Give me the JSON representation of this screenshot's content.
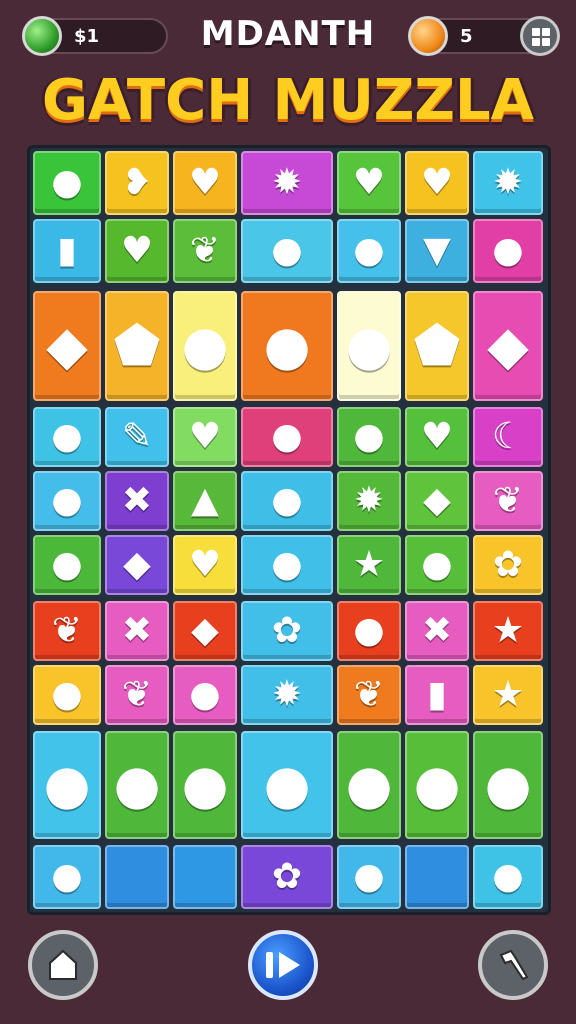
{
  "header": {
    "coins_value": "$1",
    "app_title": "MDANTH",
    "lives_value": "5",
    "coin_icon": "green-gem-icon",
    "lives_icon": "orange-gem-icon",
    "menu_icon": "grid-menu-icon"
  },
  "game_title": "GATCH MUZZLA",
  "board": {
    "tiles": [
      {
        "row": 0,
        "col": 0,
        "color": "#39c43a",
        "piece": "green-blob",
        "glyph": "●"
      },
      {
        "row": 0,
        "col": 1,
        "color": "#f6c21f",
        "piece": "red-chili",
        "glyph": "❥"
      },
      {
        "row": 0,
        "col": 2,
        "color": "#f6b41f",
        "piece": "orange-heart",
        "glyph": "♥"
      },
      {
        "row": 0,
        "col": 3,
        "color": "#c64ad6",
        "piece": "red-splat",
        "glyph": "✹"
      },
      {
        "row": 0,
        "col": 4,
        "color": "#56c53c",
        "piece": "purple-heart",
        "glyph": "♥"
      },
      {
        "row": 0,
        "col": 5,
        "color": "#f6c21f",
        "piece": "orange-heart",
        "glyph": "♥"
      },
      {
        "row": 0,
        "col": 6,
        "color": "#3fc3e8",
        "piece": "blue-star",
        "glyph": "✹"
      },
      {
        "row": 1,
        "col": 0,
        "color": "#3ab8e6",
        "piece": "purple-bar",
        "glyph": "▮"
      },
      {
        "row": 1,
        "col": 1,
        "color": "#55b82d",
        "piece": "yellow-heart",
        "glyph": "♥"
      },
      {
        "row": 1,
        "col": 2,
        "color": "#5bbd3a",
        "piece": "yellow-leaf",
        "glyph": "❦"
      },
      {
        "row": 1,
        "col": 3,
        "color": "#49c6e8",
        "piece": "purple-berry",
        "glyph": "●"
      },
      {
        "row": 1,
        "col": 4,
        "color": "#44c0ea",
        "piece": "purple-drop",
        "glyph": "●"
      },
      {
        "row": 1,
        "col": 5,
        "color": "#3db0e0",
        "piece": "striped-cone",
        "glyph": "▼"
      },
      {
        "row": 1,
        "col": 6,
        "color": "#e23fa6",
        "piece": "blue-ball",
        "glyph": "●"
      },
      {
        "row": 2,
        "col": 0,
        "color": "#f07a1e",
        "piece": "green-diamond",
        "glyph": "◆"
      },
      {
        "row": 2,
        "col": 1,
        "color": "#f5b329",
        "piece": "red-gem",
        "glyph": "⬟"
      },
      {
        "row": 2,
        "col": 2,
        "color": "#f8f07a",
        "piece": "green-drop",
        "glyph": "●"
      },
      {
        "row": 2,
        "col": 3,
        "color": "#f0791f",
        "piece": "orange-blob",
        "glyph": "●"
      },
      {
        "row": 2,
        "col": 4,
        "color": "#fcfbd2",
        "piece": "green-lizard",
        "glyph": "●"
      },
      {
        "row": 2,
        "col": 5,
        "color": "#f5c72a",
        "piece": "red-gem",
        "glyph": "⬟"
      },
      {
        "row": 2,
        "col": 6,
        "color": "#e64cb2",
        "piece": "purple-diamond",
        "glyph": "◆"
      },
      {
        "row": 3,
        "col": 0,
        "color": "#3ec2e6",
        "piece": "purple-ghost",
        "glyph": "●"
      },
      {
        "row": 3,
        "col": 1,
        "color": "#40c0ea",
        "piece": "orange-ribbon",
        "glyph": "✎"
      },
      {
        "row": 3,
        "col": 2,
        "color": "#82dc62",
        "piece": "pink-heart",
        "glyph": "♥"
      },
      {
        "row": 3,
        "col": 3,
        "color": "#e0407a",
        "piece": "red-strawberry",
        "glyph": "●"
      },
      {
        "row": 3,
        "col": 4,
        "color": "#4fb83a",
        "piece": "red-bean",
        "glyph": "●"
      },
      {
        "row": 3,
        "col": 5,
        "color": "#55c03c",
        "piece": "purple-heart",
        "glyph": "♥"
      },
      {
        "row": 3,
        "col": 6,
        "color": "#d840c8",
        "piece": "yellow-banana",
        "glyph": "☾"
      },
      {
        "row": 4,
        "col": 0,
        "color": "#45bdea",
        "piece": "orange-bean",
        "glyph": "●"
      },
      {
        "row": 4,
        "col": 1,
        "color": "#7e3ed0",
        "piece": "red-cross",
        "glyph": "✖"
      },
      {
        "row": 4,
        "col": 2,
        "color": "#57b83a",
        "piece": "orange-fruit",
        "glyph": "▲"
      },
      {
        "row": 4,
        "col": 3,
        "color": "#3fbfe8",
        "piece": "red-berry",
        "glyph": "●"
      },
      {
        "row": 4,
        "col": 4,
        "color": "#54b838",
        "piece": "yellow-splat",
        "glyph": "✹"
      },
      {
        "row": 4,
        "col": 5,
        "color": "#5fc33c",
        "piece": "green-crystal",
        "glyph": "◆"
      },
      {
        "row": 4,
        "col": 6,
        "color": "#e65cc0",
        "piece": "blue-leaf",
        "glyph": "❦"
      },
      {
        "row": 5,
        "col": 0,
        "color": "#4cb83a",
        "piece": "red-apple",
        "glyph": "●"
      },
      {
        "row": 5,
        "col": 1,
        "color": "#7a48d8",
        "piece": "blue-crystal",
        "glyph": "◆"
      },
      {
        "row": 5,
        "col": 2,
        "color": "#f8de3a",
        "piece": "purple-heart",
        "glyph": "♥"
      },
      {
        "row": 5,
        "col": 3,
        "color": "#40bfe8",
        "piece": "yellow-blob",
        "glyph": "●"
      },
      {
        "row": 5,
        "col": 4,
        "color": "#4fb83a",
        "piece": "yellow-star",
        "glyph": "★"
      },
      {
        "row": 5,
        "col": 5,
        "color": "#57be3a",
        "piece": "purple-sock",
        "glyph": "●"
      },
      {
        "row": 5,
        "col": 6,
        "color": "#f8c42a",
        "piece": "blue-flower",
        "glyph": "✿"
      },
      {
        "row": 6,
        "col": 0,
        "color": "#e8401e",
        "piece": "green-leaf",
        "glyph": "❦"
      },
      {
        "row": 6,
        "col": 1,
        "color": "#e65cc0",
        "piece": "pink-cross",
        "glyph": "✖"
      },
      {
        "row": 6,
        "col": 2,
        "color": "#e8401e",
        "piece": "blue-crystal",
        "glyph": "◆"
      },
      {
        "row": 6,
        "col": 3,
        "color": "#42bfe8",
        "piece": "purple-flower",
        "glyph": "✿"
      },
      {
        "row": 6,
        "col": 4,
        "color": "#e8401e",
        "piece": "red-bean",
        "glyph": "●"
      },
      {
        "row": 6,
        "col": 5,
        "color": "#e65cc0",
        "piece": "pink-cross",
        "glyph": "✖"
      },
      {
        "row": 6,
        "col": 6,
        "color": "#e8401e",
        "piece": "orange-star",
        "glyph": "★"
      },
      {
        "row": 7,
        "col": 0,
        "color": "#f8c42a",
        "piece": "orange-bean",
        "glyph": "●"
      },
      {
        "row": 7,
        "col": 1,
        "color": "#e65cc0",
        "piece": "orange-feather",
        "glyph": "❦"
      },
      {
        "row": 7,
        "col": 2,
        "color": "#e65cc0",
        "piece": "orange-bean",
        "glyph": "●"
      },
      {
        "row": 7,
        "col": 3,
        "color": "#42bfe8",
        "piece": "orange-sun",
        "glyph": "✹"
      },
      {
        "row": 7,
        "col": 4,
        "color": "#f07a1e",
        "piece": "green-leaf",
        "glyph": "❦"
      },
      {
        "row": 7,
        "col": 5,
        "color": "#e65cc0",
        "piece": "pink-bar",
        "glyph": "▮"
      },
      {
        "row": 7,
        "col": 6,
        "color": "#f8c42a",
        "piece": "yellow-star",
        "glyph": "★"
      },
      {
        "row": 8,
        "col": 0,
        "color": "#42c4ea",
        "piece": "purple-eggplant",
        "glyph": "●"
      },
      {
        "row": 8,
        "col": 1,
        "color": "#4fb83a",
        "piece": "pineapple",
        "glyph": "●"
      },
      {
        "row": 8,
        "col": 2,
        "color": "#4fb83a",
        "piece": "orange-carrot",
        "glyph": "●"
      },
      {
        "row": 8,
        "col": 3,
        "color": "#42c4ea",
        "piece": "orange-mango",
        "glyph": "●"
      },
      {
        "row": 8,
        "col": 4,
        "color": "#4fb83a",
        "piece": "white-onion",
        "glyph": "●"
      },
      {
        "row": 8,
        "col": 5,
        "color": "#57be3a",
        "piece": "yellow-pear",
        "glyph": "●"
      },
      {
        "row": 8,
        "col": 6,
        "color": "#4fb83a",
        "piece": "orange-mango",
        "glyph": "●"
      },
      {
        "row": 9,
        "col": 0,
        "color": "#42b8ea",
        "piece": "green-melon",
        "glyph": "●"
      },
      {
        "row": 9,
        "col": 1,
        "color": "#2f8ee0",
        "piece": "",
        "glyph": ""
      },
      {
        "row": 9,
        "col": 2,
        "color": "#2f98e4",
        "piece": "",
        "glyph": ""
      },
      {
        "row": 9,
        "col": 3,
        "color": "#7a48d8",
        "piece": "pink-flower",
        "glyph": "✿"
      },
      {
        "row": 9,
        "col": 4,
        "color": "#42b8ea",
        "piece": "green-apple",
        "glyph": "●"
      },
      {
        "row": 9,
        "col": 5,
        "color": "#2f8ee0",
        "piece": "",
        "glyph": ""
      },
      {
        "row": 9,
        "col": 6,
        "color": "#3ec2e6",
        "piece": "green-kiwi",
        "glyph": "●"
      }
    ]
  },
  "controls": {
    "left_icon": "home-icon",
    "center_icon": "play-icon",
    "right_icon": "hammer-icon"
  }
}
